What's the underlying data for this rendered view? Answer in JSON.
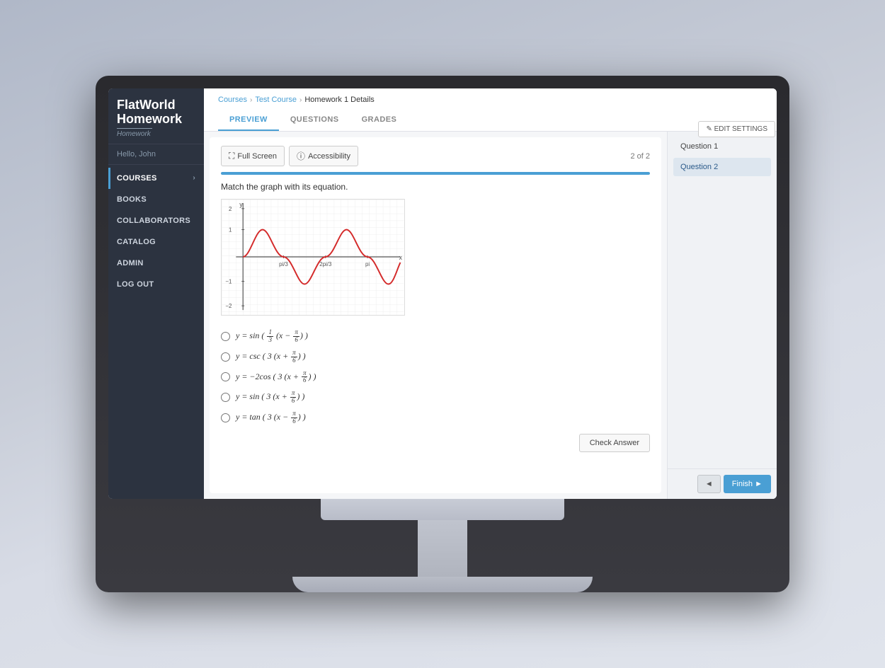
{
  "app": {
    "title": "FlatWorld Homework"
  },
  "sidebar": {
    "logo_brand": "FlatWorld",
    "logo_sub": "Homework",
    "user_greeting": "Hello, John",
    "items": [
      {
        "id": "courses",
        "label": "COURSES",
        "active": true,
        "has_chevron": true
      },
      {
        "id": "books",
        "label": "BOOKS",
        "active": false,
        "has_chevron": false
      },
      {
        "id": "collaborators",
        "label": "COLLABORATORS",
        "active": false,
        "has_chevron": false
      },
      {
        "id": "catalog",
        "label": "CATALOG",
        "active": false,
        "has_chevron": false
      },
      {
        "id": "admin",
        "label": "ADMIN",
        "active": false,
        "has_chevron": false
      },
      {
        "id": "logout",
        "label": "LOG OUT",
        "active": false,
        "has_chevron": false
      }
    ]
  },
  "breadcrumb": {
    "items": [
      "Courses",
      "Test Course",
      "Homework 1 Details"
    ],
    "separators": [
      ">",
      ">"
    ]
  },
  "edit_settings_btn": "✎ EDIT SETTINGS",
  "tabs": [
    {
      "id": "preview",
      "label": "PREVIEW",
      "active": true
    },
    {
      "id": "questions",
      "label": "QUESTIONS",
      "active": false
    },
    {
      "id": "grades",
      "label": "GRADES",
      "active": false
    }
  ],
  "toolbar": {
    "fullscreen_btn": "Full Screen",
    "accessibility_btn": "Accessibility",
    "question_count": "2 of 2"
  },
  "question": {
    "prompt": "Match the graph with its equation.",
    "progress_percent": 100,
    "options": [
      {
        "id": "opt1",
        "formula_html": "y = sin ( <span class='fraction'><span class='num'>1</span><span class='den'>3</span></span> (x − <span class='fraction'><span class='num'>π</span><span class='den'>6</span></span>) )"
      },
      {
        "id": "opt2",
        "formula_html": "y = csc ( 3 (x + <span class='fraction'><span class='num'>π</span><span class='den'>6</span></span>) )"
      },
      {
        "id": "opt3",
        "formula_html": "y = −2cos ( 3 (x + <span class='fraction'><span class='num'>π</span><span class='den'>6</span></span>) )"
      },
      {
        "id": "opt4",
        "formula_html": "y = sin ( 3 (x + <span class='fraction'><span class='num'>π</span><span class='den'>6</span></span>) )"
      },
      {
        "id": "opt5",
        "formula_html": "y = tan ( 3 (x − <span class='fraction'><span class='num'>π</span><span class='den'>6</span></span>) )"
      }
    ],
    "check_answer_btn": "Check Answer"
  },
  "question_list": {
    "items": [
      {
        "label": "Question  1",
        "active": false
      },
      {
        "label": "Question  2",
        "active": true
      }
    ]
  },
  "navigation": {
    "prev_btn": "◄",
    "finish_btn": "Finish ►"
  }
}
